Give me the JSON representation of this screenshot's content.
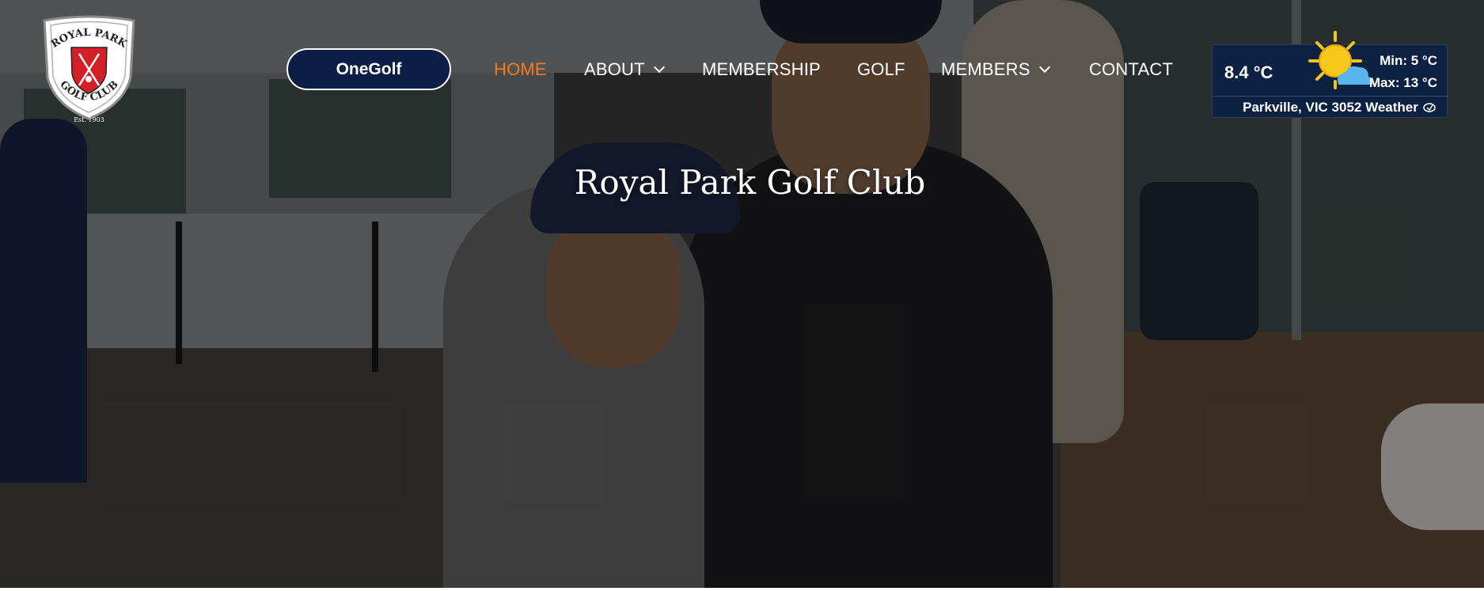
{
  "brand": {
    "logo_top_text": "ROYAL PARK",
    "logo_bottom_text": "GOLF CLUB",
    "logo_est": "Est. 1903",
    "logo_icon": "crossed-clubs-shield-icon",
    "colors": {
      "shield_red": "#d32027",
      "accent_orange": "#f07a1e",
      "navy": "#0c1d46"
    }
  },
  "header": {
    "onegolf_label": "OneGolf",
    "nav": [
      {
        "label": "HOME",
        "active": true,
        "has_dropdown": false
      },
      {
        "label": "ABOUT",
        "active": false,
        "has_dropdown": true
      },
      {
        "label": "MEMBERSHIP",
        "active": false,
        "has_dropdown": false
      },
      {
        "label": "GOLF",
        "active": false,
        "has_dropdown": false
      },
      {
        "label": "MEMBERS",
        "active": false,
        "has_dropdown": true
      },
      {
        "label": "CONTACT",
        "active": false,
        "has_dropdown": false
      }
    ]
  },
  "weather": {
    "current": "8.4 °C",
    "min": "Min: 5 °C",
    "max": "Max: 13 °C",
    "location": "Parkville, VIC 3052 Weather",
    "icon": "sun-behind-cloud-icon"
  },
  "hero": {
    "title": "Royal Park Golf Club",
    "image_subject": "smiling-couple-photo"
  }
}
